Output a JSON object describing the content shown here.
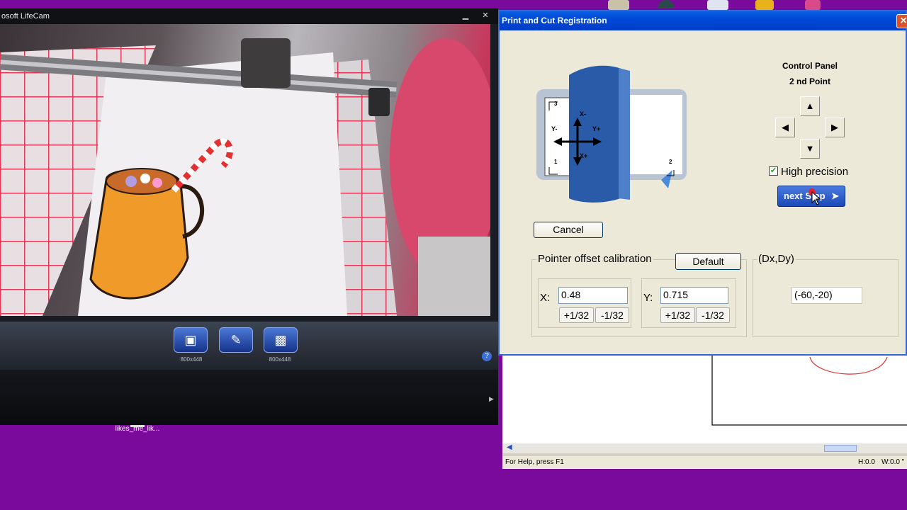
{
  "colors": {
    "desktop": "#7a0a9c",
    "xp_title": "#0048d8",
    "accent_red": "#e23030"
  },
  "lifecam": {
    "title": "osoft LifeCam",
    "minimize_icon": "minimize-icon",
    "close_icon": "close-icon",
    "buttons": [
      {
        "icon": "camera-icon",
        "resolution": "800x448"
      },
      {
        "icon": "pen-icon",
        "resolution": ""
      },
      {
        "icon": "video-camera-icon",
        "resolution": "800x448"
      }
    ],
    "help_icon": "?"
  },
  "desktop": {
    "file_label": "likes_me_lik..."
  },
  "dialog": {
    "title": "Print and Cut Registration",
    "close_icon": "✕",
    "control_panel_title": "Control Panel",
    "control_panel_point": "2 nd Point",
    "arrows": {
      "up": "▲",
      "left": "◀",
      "right": "▶",
      "down": "▼"
    },
    "high_precision_label": "High precision",
    "high_precision_checked": true,
    "next_step_label": "next Step",
    "cancel_label": "Cancel",
    "diagram": {
      "axis_y_minus": "Y-",
      "axis_y_plus": "Y+",
      "axis_x_minus": "X-",
      "axis_x_plus": "X+",
      "corner_1": "1",
      "corner_2": "2",
      "corner_3": "3"
    },
    "pointer_offset_label": "Pointer offset calibration",
    "default_label": "Default",
    "x_label": "X:",
    "x_value": "0.48",
    "y_label": "Y:",
    "y_value": "0.715",
    "plus_label": "+1/32",
    "minus_label": "-1/32",
    "dxdy_label": "(Dx,Dy)",
    "dxdy_value": "(-60,-20)"
  },
  "app": {
    "status_text": "For Help, press F1",
    "status_h": "H:0.0",
    "status_w": "W:0.0 \""
  }
}
